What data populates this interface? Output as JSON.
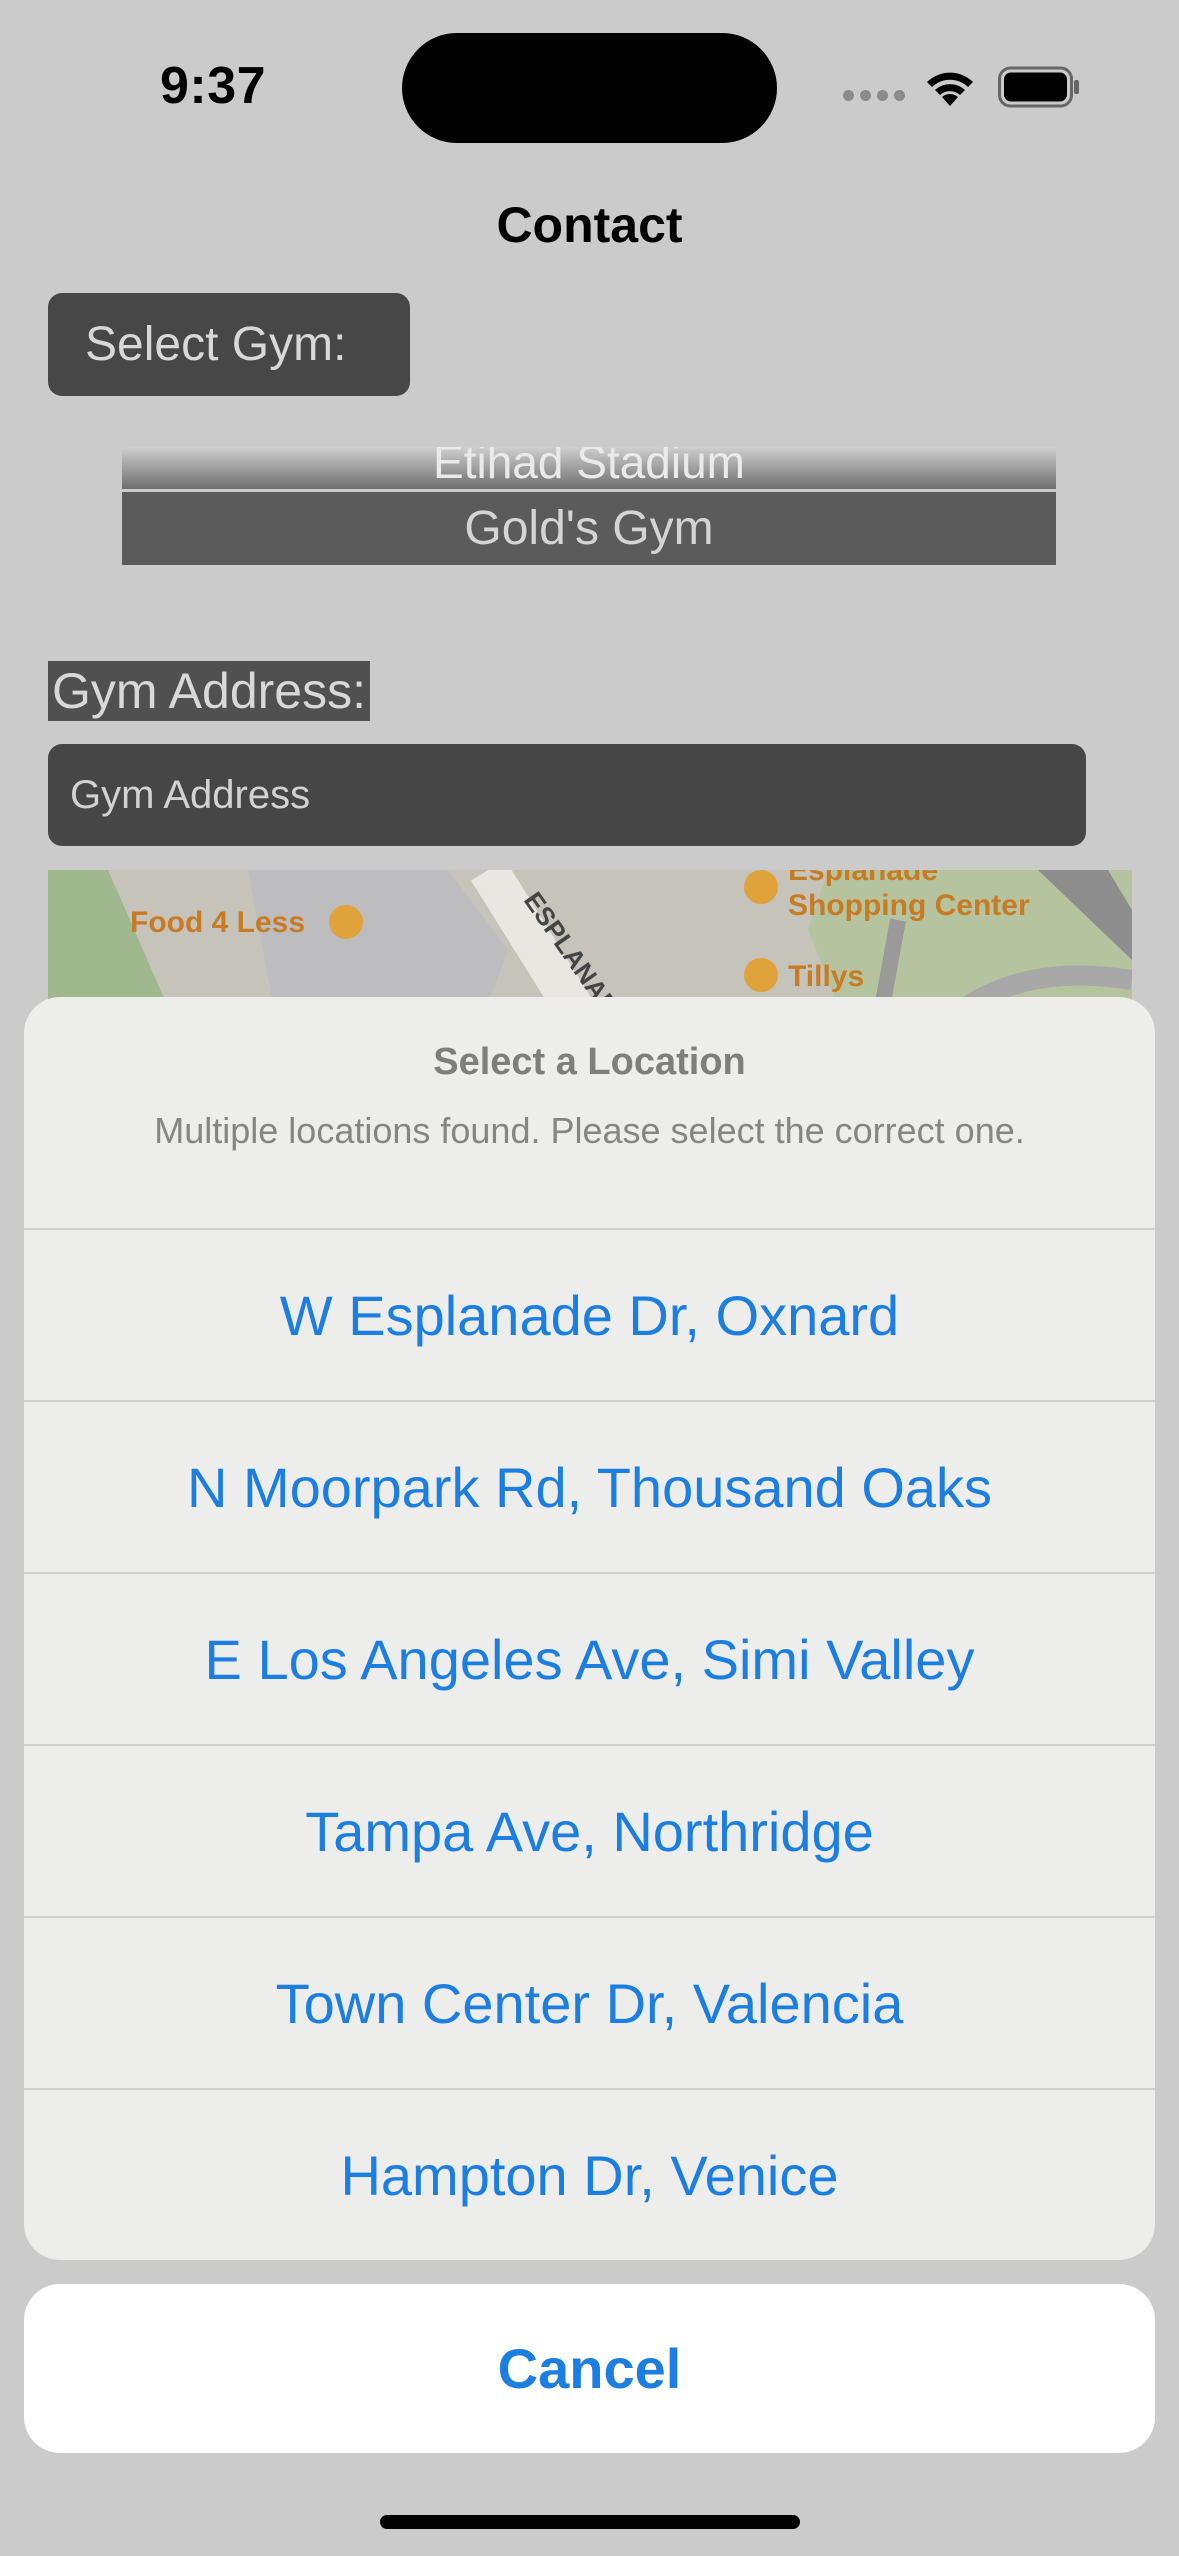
{
  "status_bar": {
    "time": "9:37"
  },
  "nav": {
    "title": "Contact"
  },
  "form": {
    "select_gym_label": "Select Gym:",
    "picker_prev_item": "Etihad Stadium",
    "picker_selected_item": "Gold's Gym",
    "address_label": "Gym Address:",
    "address_placeholder": "Gym Address"
  },
  "map": {
    "labels": {
      "food4less": "Food 4 Less",
      "esplanade_street": "ESPLANADE DR",
      "esplanade_line1": "Esplanade",
      "esplanade_line2": "Shopping Center",
      "tillys": "Tillys"
    }
  },
  "action_sheet": {
    "title": "Select a Location",
    "message": "Multiple locations found. Please select the correct one.",
    "options": [
      "W Esplanade Dr, Oxnard",
      "N Moorpark Rd, Thousand Oaks",
      "E Los Angeles Ave, Simi Valley",
      "Tampa Ave, Northridge",
      "Town Center Dr, Valencia",
      "Hampton Dr, Venice"
    ],
    "cancel_label": "Cancel"
  },
  "colors": {
    "accent": "#1b7ee0",
    "dim_background": "#cbcbcb",
    "sheet": "#ededeb"
  }
}
